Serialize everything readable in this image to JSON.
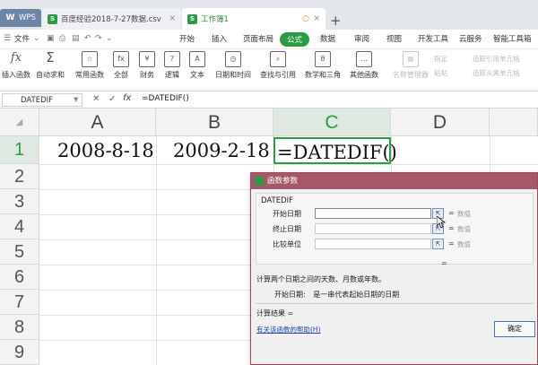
{
  "tabs": [
    {
      "label": "WPS"
    },
    {
      "label": "百度经验2018-7-27数据.csv"
    },
    {
      "label": "工作簿1"
    }
  ],
  "menu": {
    "file": "文件",
    "items": [
      "开始",
      "插入",
      "页面布局",
      "公式",
      "数据",
      "审阅",
      "视图",
      "开发工具",
      "云服务",
      "智能工具箱"
    ],
    "active": "公式"
  },
  "ribbon": {
    "buttons": [
      "插入函数",
      "自动求和",
      "常用函数",
      "全部",
      "财务",
      "逻辑",
      "文本",
      "日期和时间",
      "查找与引用",
      "数学和三角",
      "其他函数",
      "名称管理器"
    ],
    "small": [
      "指定",
      "粘贴",
      "追踪引用单元格",
      "追踪从属单元格"
    ]
  },
  "formula_bar": {
    "name_box": "DATEDIF",
    "fx": "fx",
    "content": "=DATEDIF()"
  },
  "sheet": {
    "columns": [
      "A",
      "B",
      "C",
      "D"
    ],
    "rows": [
      "1",
      "2",
      "3",
      "4",
      "5",
      "6",
      "7",
      "8",
      "9"
    ],
    "selected_column": "C",
    "selected_row": "1",
    "cells": {
      "A1": "2008-8-18",
      "B1": "2009-2-18",
      "C1": "=DATEDIF()"
    }
  },
  "dialog": {
    "title": "函数参数",
    "function_name": "DATEDIF",
    "args": [
      {
        "label": "开始日期",
        "hint": "数值"
      },
      {
        "label": "终止日期",
        "hint": "数值"
      },
      {
        "label": "比较单位",
        "hint": "数值"
      }
    ],
    "equals": "=",
    "description": "计算两个日期之间的天数、月数或年数。",
    "arg_help_label": "开始日期:",
    "arg_help_text": "是一串代表起始日期的日期",
    "result_label": "计算结果 =",
    "help_link": "有关该函数的帮助(H)",
    "ok": "确定"
  },
  "colors": {
    "accent_green": "#2d9a45",
    "dialog_title": "#a45868",
    "tab_bg": "#e3e7ec"
  }
}
